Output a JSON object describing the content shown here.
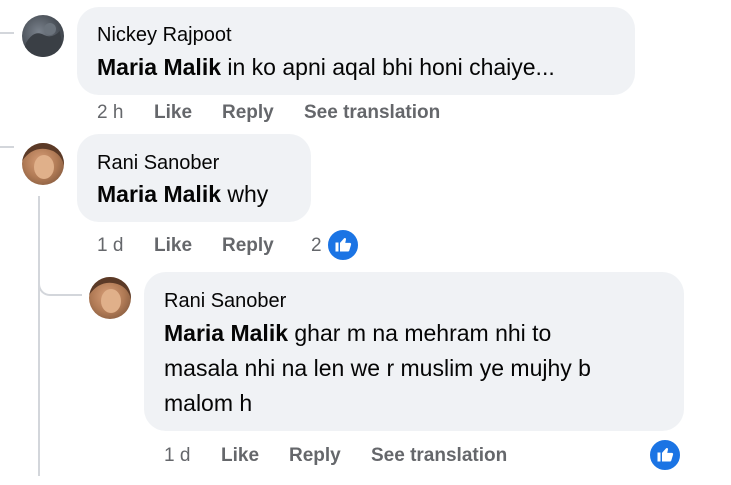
{
  "comments": [
    {
      "author": "Nickey Rajpoot",
      "mention": "Maria Malik",
      "text": "in ko apni aqal bhi honi chaiye...",
      "time": "2 h",
      "like_label": "Like",
      "reply_label": "Reply",
      "translate_label": "See translation"
    },
    {
      "author": "Rani Sanober",
      "mention": "Maria Malik",
      "text": "why",
      "time": "1 d",
      "like_label": "Like",
      "reply_label": "Reply",
      "reaction_count": "2"
    },
    {
      "author": "Rani Sanober",
      "mention": "Maria Malik",
      "text_lines": [
        "ghar m na mehram nhi to",
        "masala nhi na len we r muslim ye mujhy b",
        "malom h"
      ],
      "time": "1 d",
      "like_label": "Like",
      "reply_label": "Reply",
      "translate_label": "See translation"
    }
  ],
  "icons": {
    "reaction": "like-thumb-icon",
    "avatar_color_1": "#4a5058",
    "avatar_color_2": "#b07a55",
    "reaction_color": "#1b74e4"
  }
}
